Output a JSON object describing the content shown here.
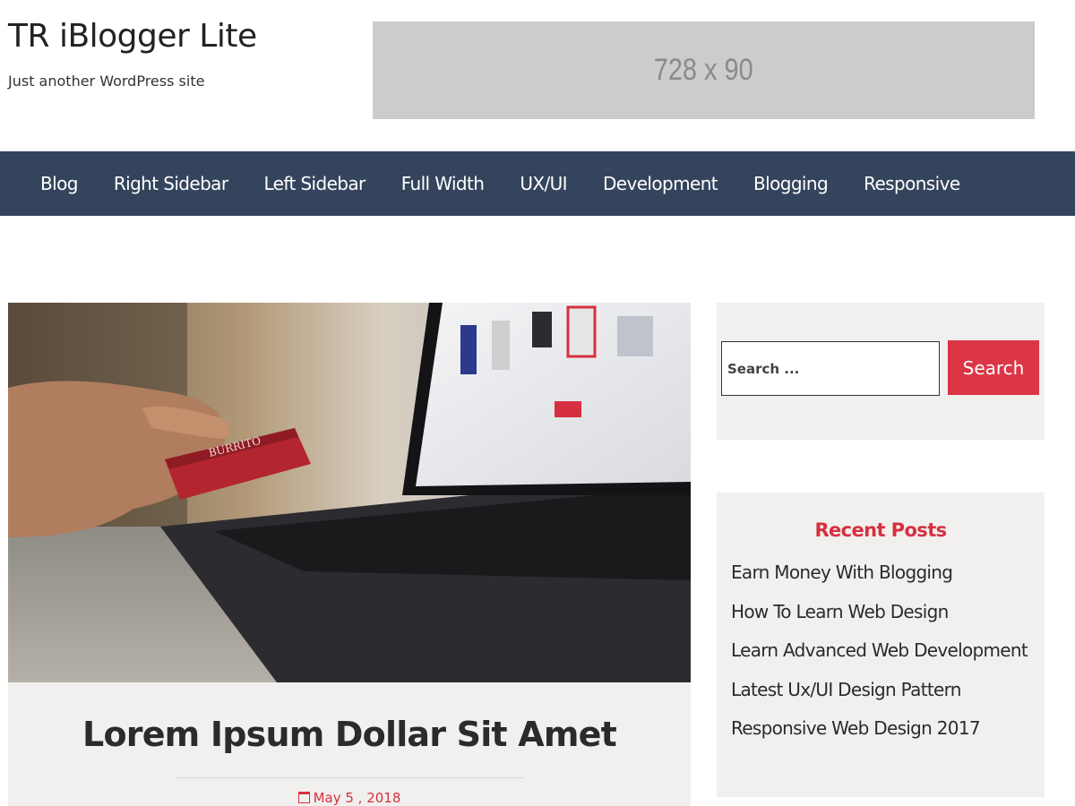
{
  "site": {
    "title": "TR iBlogger Lite",
    "tagline": "Just another WordPress site"
  },
  "ad": {
    "label": "728 x 90"
  },
  "nav": {
    "items": [
      {
        "label": "Blog"
      },
      {
        "label": "Right Sidebar"
      },
      {
        "label": "Left Sidebar"
      },
      {
        "label": "Full Width"
      },
      {
        "label": "UX/UI"
      },
      {
        "label": "Development"
      },
      {
        "label": "Blogging"
      },
      {
        "label": "Responsive"
      }
    ]
  },
  "post": {
    "title": "Lorem Ipsum Dollar Sit Amet",
    "date": "May 5 , 2018",
    "date_icon": "calendar-icon",
    "card_text": "BURRITO"
  },
  "search": {
    "placeholder": "Search ...",
    "button_label": "Search"
  },
  "recent_posts": {
    "title": "Recent Posts",
    "items": [
      {
        "label": "Earn Money With Blogging"
      },
      {
        "label": "How To Learn Web Design"
      },
      {
        "label": "Learn Advanced Web Development"
      },
      {
        "label": "Latest Ux/UI Design Pattern"
      },
      {
        "label": "Responsive Web Design 2017"
      }
    ]
  },
  "colors": {
    "nav_bg": "#34445c",
    "accent": "#dc3545",
    "widget_bg": "#f1f0ee",
    "ad_bg": "#cccccc"
  }
}
